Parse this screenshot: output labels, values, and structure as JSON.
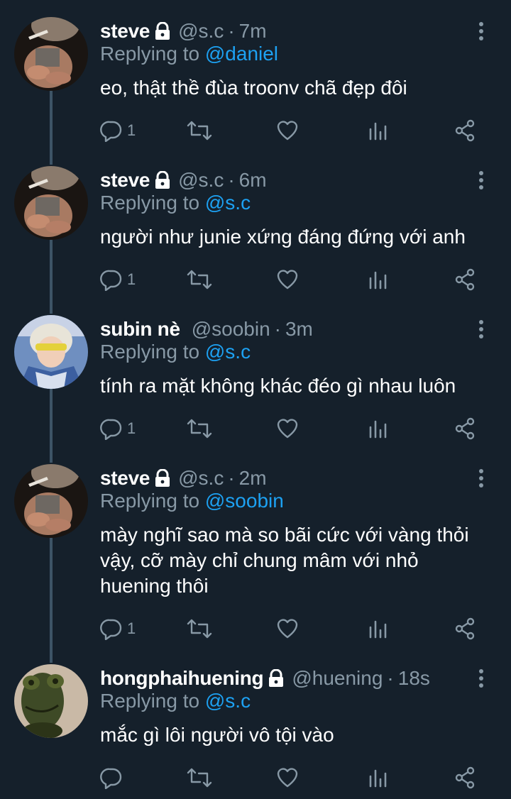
{
  "colors": {
    "background": "#15202b",
    "secondary_text": "#8899a6",
    "accent": "#1da1f2",
    "thread_line": "#3d5466"
  },
  "tweets": [
    {
      "name": "steve",
      "protected": true,
      "handle": "@s.c",
      "time": "7m",
      "replying_prefix": "Replying to",
      "replying_to": "@daniel",
      "text": "eo, thật thề đùa troonv chã đẹp đôi",
      "reply_count": "1",
      "avatar": "steve-avatar"
    },
    {
      "name": "steve",
      "protected": true,
      "handle": "@s.c",
      "time": "6m",
      "replying_prefix": "Replying to",
      "replying_to": "@s.c",
      "text": "người như junie xứng đáng đứng với anh",
      "reply_count": "1",
      "avatar": "steve-avatar"
    },
    {
      "name": "subin nè",
      "protected": false,
      "handle": "@soobin",
      "time": "3m",
      "replying_prefix": "Replying to",
      "replying_to": "@s.c",
      "text": "tính ra mặt không khác đéo gì nhau luôn",
      "reply_count": "1",
      "avatar": "subin-avatar"
    },
    {
      "name": "steve",
      "protected": true,
      "handle": "@s.c",
      "time": "2m",
      "replying_prefix": "Replying to",
      "replying_to": "@soobin",
      "text": "mày nghĩ sao mà so bãi cức với vàng thỏi vậy, cỡ mày chỉ chung mâm với nhỏ huening thôi",
      "reply_count": "1",
      "avatar": "steve-avatar"
    },
    {
      "name": "hongphaihuening",
      "protected": true,
      "handle": "@huening",
      "time": "18s",
      "replying_prefix": "Replying to",
      "replying_to": "@s.c",
      "text": "mắc gì lôi người vô tội vào",
      "reply_count": "",
      "avatar": "frog-avatar"
    }
  ]
}
